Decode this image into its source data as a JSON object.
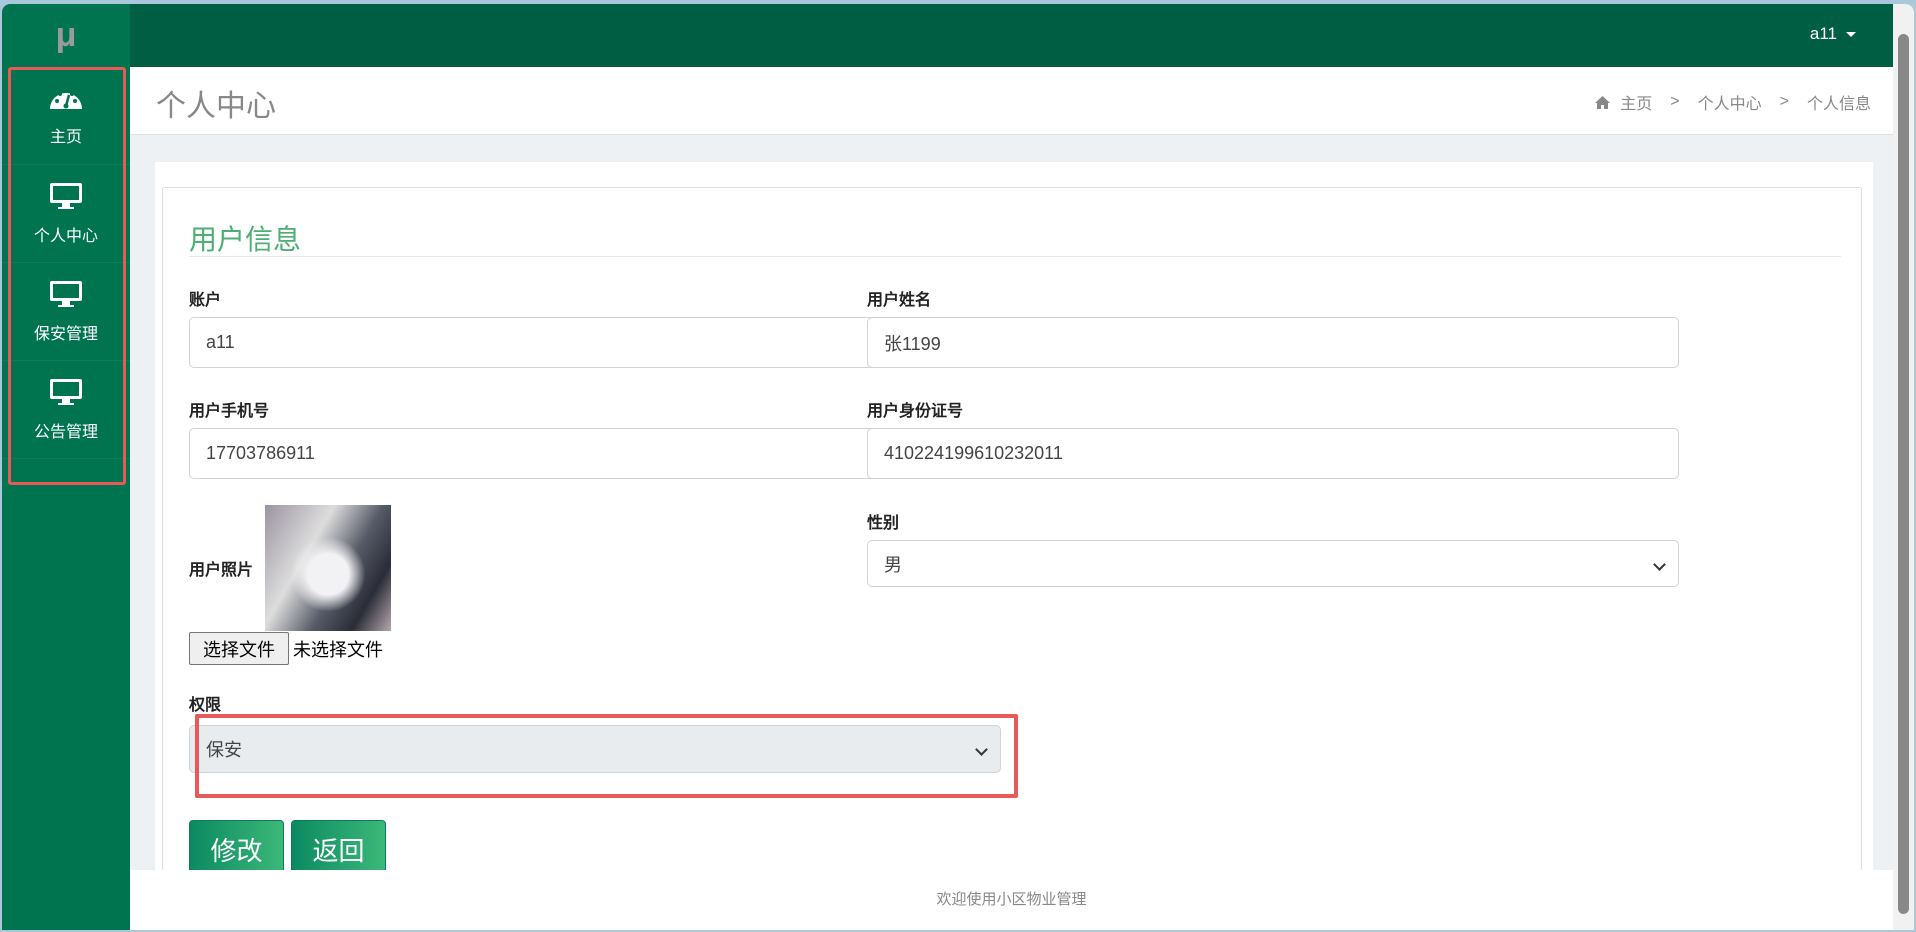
{
  "app": {
    "logo": "μ",
    "user": "a11"
  },
  "sidebar": {
    "items": [
      {
        "label": "主页",
        "icon": "dashboard-icon"
      },
      {
        "label": "个人中心",
        "icon": "monitor-icon"
      },
      {
        "label": "保安管理",
        "icon": "monitor-icon"
      },
      {
        "label": "公告管理",
        "icon": "monitor-icon"
      }
    ]
  },
  "header": {
    "title": "个人中心",
    "breadcrumb": [
      "主页",
      "个人中心",
      "个人信息"
    ],
    "sep": ">"
  },
  "form": {
    "title": "用户信息",
    "account": {
      "label": "账户",
      "value": "a11"
    },
    "name": {
      "label": "用户姓名",
      "value": "张1199"
    },
    "phone": {
      "label": "用户手机号",
      "value": "17703786911"
    },
    "idcard": {
      "label": "用户身份证号",
      "value": "410224199610232011"
    },
    "photo": {
      "label": "用户照片",
      "choose": "选择文件",
      "none": "未选择文件"
    },
    "gender": {
      "label": "性别",
      "value": "男"
    },
    "role": {
      "label": "权限",
      "value": "保安"
    },
    "submit": "修改",
    "back": "返回"
  },
  "footer": "欢迎使用小区物业管理",
  "colors": {
    "sidebar": "#00734f",
    "topbar": "#005e43",
    "accent": "#4caf73",
    "highlight": "#e85a5a"
  }
}
